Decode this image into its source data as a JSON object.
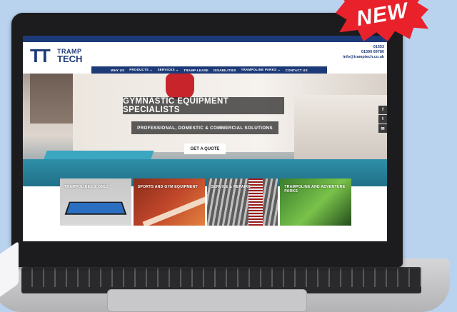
{
  "badge": {
    "label": "NEW"
  },
  "site": {
    "logo": {
      "mark": "TT",
      "line1": "TRAMP",
      "line2": "TECH"
    },
    "contact": {
      "phone1": "01653",
      "phone2": "01590 69780",
      "email": "info@tramptech.co.uk"
    },
    "nav": [
      {
        "label": "WHY US"
      },
      {
        "label": "PRODUCTS ⌄"
      },
      {
        "label": "SERVICES ⌄"
      },
      {
        "label": "TRAMP-LEASE"
      },
      {
        "label": "DISABILITIES"
      },
      {
        "label": "TRAMPOLINE PARKS ⌄"
      },
      {
        "label": "CONTACT US"
      }
    ],
    "hero": {
      "title": "GYMNASTIC EQUIPMENT SPECIALISTS",
      "subtitle": "PROFESSIONAL, DOMESTIC & COMMERCIAL SOLUTIONS",
      "cta": "GET A QUOTE"
    },
    "social": [
      {
        "glyph": "f",
        "icon": "facebook-icon"
      },
      {
        "glyph": "t",
        "icon": "twitter-icon"
      },
      {
        "glyph": "✉",
        "icon": "email-icon"
      }
    ],
    "cards": [
      {
        "label": "TRAMPOLINES & ONLY"
      },
      {
        "label": "SPORTS AND GYM EQUIPMENT"
      },
      {
        "label": "SERVICE & REPAIRS"
      },
      {
        "label": "TRAMPOLINE AND ADVENTURE PARKS"
      }
    ]
  },
  "colors": {
    "brand": "#1d3a78",
    "badge": "#e8212b",
    "background": "#b9d3ef"
  }
}
